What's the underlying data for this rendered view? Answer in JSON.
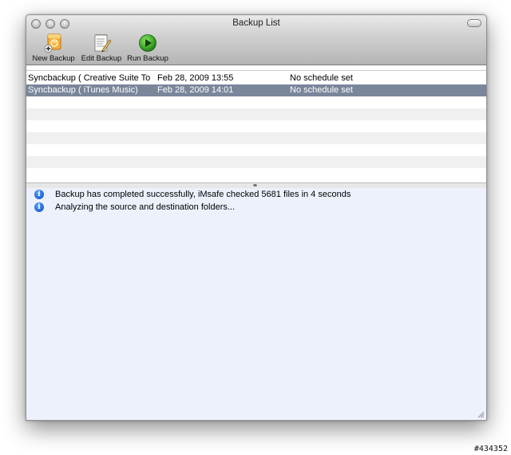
{
  "window": {
    "title": "Backup List"
  },
  "toolbar": {
    "items": [
      {
        "label": "New Backup",
        "icon": "new-backup-icon"
      },
      {
        "label": "Edit Backup",
        "icon": "edit-backup-icon"
      },
      {
        "label": "Run Backup",
        "icon": "run-backup-icon"
      }
    ]
  },
  "backup_list": {
    "rows": [
      {
        "name": "Syncbackup ( Creative Suite To",
        "date": "Feb 28, 2009 13:55",
        "schedule": "No schedule set",
        "selected": false
      },
      {
        "name": "Syncbackup ( iTunes Music)",
        "date": "Feb 28, 2009 14:01",
        "schedule": "No schedule set",
        "selected": true
      }
    ]
  },
  "log": {
    "messages": [
      {
        "icon": "info-icon",
        "text": "Backup has completed successfully, iMsafe checked 5681 files in 4 seconds"
      },
      {
        "icon": "info-icon",
        "text": "Analyzing the source and destination folders..."
      }
    ]
  },
  "watermark": "#434352",
  "colors": {
    "selection": "#7a869a",
    "log_background": "#ecf1fc",
    "info_icon": "#1d5fd0",
    "run_icon": "#3fae2a",
    "new_icon": "#f0a020"
  }
}
